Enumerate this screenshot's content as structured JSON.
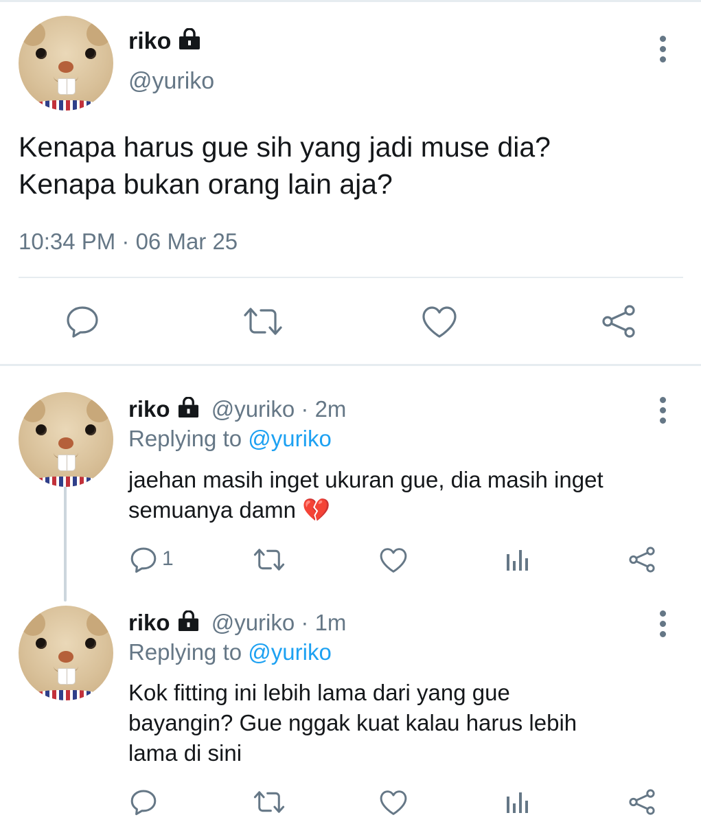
{
  "main_tweet": {
    "name": "riko",
    "handle": "@yuriko",
    "text_line1": "Kenapa harus gue sih yang jadi muse dia?",
    "text_line2": "Kenapa bukan orang lain aja?",
    "timestamp": "10:34 PM · 06 Mar 25",
    "actions": [
      "comment-icon",
      "retweet-icon",
      "heart-icon",
      "share-icon"
    ]
  },
  "replies": [
    {
      "name": "riko",
      "handle": "@yuriko",
      "time": "· 2m",
      "replying_prefix": "Replying to",
      "replying_to": "@yuriko",
      "text_line1": "jaehan masih inget ukuran gue, dia masih inget",
      "text_line2": "semuanya damn 💔",
      "reply_count": "1"
    },
    {
      "name": "riko",
      "handle": "@yuriko",
      "time": "· 1m",
      "replying_prefix": "Replying to",
      "replying_to": "@yuriko",
      "text_line1": "Kok fitting ini lebih lama dari yang gue",
      "text_line2": "bayangin? Gue nggak kuat kalau harus lebih",
      "text_line3": "lama di sini",
      "reply_count": ""
    }
  ],
  "colors": {
    "text": "#14171a",
    "muted": "#657786",
    "link": "#1da1f2",
    "divider": "#e6ecf0"
  }
}
